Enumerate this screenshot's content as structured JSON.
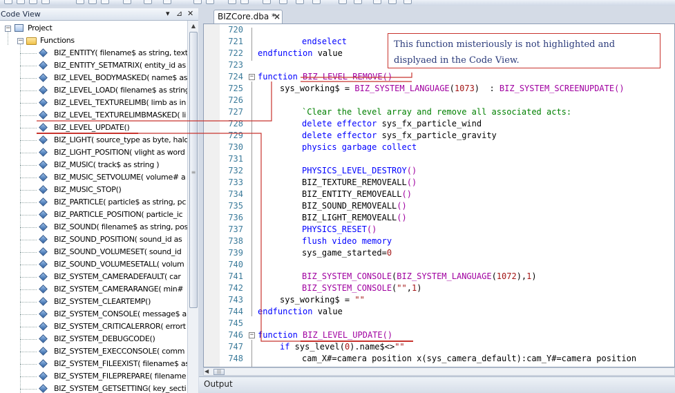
{
  "left_panel": {
    "title": "Code View",
    "pin_icon": "pin-icon",
    "close_icon": "close-icon",
    "tree": {
      "project": "Project",
      "functions_folder": "Functions",
      "items": [
        "BIZ_ENTITY( filename$ as string, text",
        "BIZ_ENTITY_SETMATRIX( entity_id as",
        "BIZ_LEVEL_BODYMASKED( name$ as",
        "BIZ_LEVEL_LOAD( filename$ as string",
        "BIZ_LEVEL_TEXTURELIMB( limb as in",
        "BIZ_LEVEL_TEXTURELIMBMASKED( li",
        "BIZ_LEVEL_UPDATE()",
        "BIZ_LIGHT( source_type as byte, halo",
        "BIZ_LIGHT_POSITION( vlight as word",
        "BIZ_MUSIC( track$ as string )",
        "BIZ_MUSIC_SETVOLUME( volume# a",
        "BIZ_MUSIC_STOP()",
        "BIZ_PARTICLE( particle$ as string, pc",
        "BIZ_PARTICLE_POSITION( particle_ic",
        "BIZ_SOUND( filename$ as string, pos",
        "BIZ_SOUND_POSITION( sound_id as",
        "BIZ_SOUND_VOLUMESET( sound_id",
        "BIZ_SOUND_VOLUMESETALL( volum",
        "BIZ_SYSTEM_CAMERADEFAULT( car",
        "BIZ_SYSTEM_CAMERARANGE( min#",
        "BIZ_SYSTEM_CLEARTEMP()",
        "BIZ_SYSTEM_CONSOLE( message$ a",
        "BIZ_SYSTEM_CRITICALERROR( errort",
        "BIZ_SYSTEM_DEBUGCODE()",
        "BIZ_SYSTEM_EXECCONSOLE( comm",
        "BIZ_SYSTEM_FILEEXIST( filename$ as",
        "BIZ_SYSTEM_FILEPREPARE( filename",
        "BIZ_SYSTEM_GETSETTING( key_secti"
      ]
    }
  },
  "editor": {
    "tab_label": "BIZCore.dba *",
    "tab_close": "×",
    "lines": [
      {
        "n": "720",
        "indent": 0,
        "tokens": []
      },
      {
        "n": "721",
        "indent": 2,
        "tokens": [
          {
            "t": "kw",
            "v": "endselect"
          }
        ]
      },
      {
        "n": "722",
        "indent": 0,
        "tokens": [
          {
            "t": "kw",
            "v": "endfunction"
          },
          {
            "t": "pl",
            "v": " value"
          }
        ]
      },
      {
        "n": "723",
        "indent": 0,
        "tokens": []
      },
      {
        "n": "724",
        "indent": 0,
        "tokens": [
          {
            "t": "kw",
            "v": "function"
          },
          {
            "t": "pl",
            "v": " "
          },
          {
            "t": "fnc",
            "v": "BIZ_LEVEL_REMOVE"
          },
          {
            "t": "fnc",
            "v": "()"
          }
        ]
      },
      {
        "n": "725",
        "indent": 1,
        "tokens": [
          {
            "t": "pl",
            "v": "sys_working$ = "
          },
          {
            "t": "fnc",
            "v": "BIZ_SYSTEM_LANGUAGE"
          },
          {
            "t": "pl",
            "v": "("
          },
          {
            "t": "st",
            "v": "1073"
          },
          {
            "t": "pl",
            "v": ")  : "
          },
          {
            "t": "fnc",
            "v": "BIZ_SYSTEM_SCREENUPDATE"
          },
          {
            "t": "fnc",
            "v": "()"
          }
        ]
      },
      {
        "n": "726",
        "indent": 0,
        "tokens": []
      },
      {
        "n": "727",
        "indent": 2,
        "tokens": [
          {
            "t": "cm",
            "v": "`Clear the level array and remove all associated acts:"
          }
        ]
      },
      {
        "n": "728",
        "indent": 2,
        "tokens": [
          {
            "t": "kw",
            "v": "delete effector"
          },
          {
            "t": "pl",
            "v": " sys_fx_particle_wind"
          }
        ]
      },
      {
        "n": "729",
        "indent": 2,
        "tokens": [
          {
            "t": "kw",
            "v": "delete effector"
          },
          {
            "t": "pl",
            "v": " sys_fx_particle_gravity"
          }
        ]
      },
      {
        "n": "730",
        "indent": 2,
        "tokens": [
          {
            "t": "kw",
            "v": "physics garbage collect"
          }
        ]
      },
      {
        "n": "731",
        "indent": 0,
        "tokens": []
      },
      {
        "n": "732",
        "indent": 2,
        "tokens": [
          {
            "t": "kw",
            "v": "PHYSICS_LEVEL_DESTROY"
          },
          {
            "t": "fnc",
            "v": "()"
          }
        ]
      },
      {
        "n": "733",
        "indent": 2,
        "tokens": [
          {
            "t": "pl",
            "v": "BIZ_TEXTURE_REMOVEALL"
          },
          {
            "t": "fnc",
            "v": "()"
          }
        ]
      },
      {
        "n": "734",
        "indent": 2,
        "tokens": [
          {
            "t": "pl",
            "v": "BIZ_ENTITY_REMOVEALL"
          },
          {
            "t": "fnc",
            "v": "()"
          }
        ]
      },
      {
        "n": "735",
        "indent": 2,
        "tokens": [
          {
            "t": "pl",
            "v": "BIZ_SOUND_REMOVEALL"
          },
          {
            "t": "fnc",
            "v": "()"
          }
        ]
      },
      {
        "n": "736",
        "indent": 2,
        "tokens": [
          {
            "t": "pl",
            "v": "BIZ_LIGHT_REMOVEALL"
          },
          {
            "t": "fnc",
            "v": "()"
          }
        ]
      },
      {
        "n": "737",
        "indent": 2,
        "tokens": [
          {
            "t": "kw",
            "v": "PHYSICS_RESET"
          },
          {
            "t": "fnc",
            "v": "()"
          }
        ]
      },
      {
        "n": "738",
        "indent": 2,
        "tokens": [
          {
            "t": "kw",
            "v": "flush video memory"
          }
        ]
      },
      {
        "n": "739",
        "indent": 2,
        "tokens": [
          {
            "t": "pl",
            "v": "sys_game_started="
          },
          {
            "t": "st",
            "v": "0"
          }
        ]
      },
      {
        "n": "740",
        "indent": 0,
        "tokens": []
      },
      {
        "n": "741",
        "indent": 2,
        "tokens": [
          {
            "t": "fnc",
            "v": "BIZ_SYSTEM_CONSOLE"
          },
          {
            "t": "pl",
            "v": "("
          },
          {
            "t": "fnc",
            "v": "BIZ_SYSTEM_LANGUAGE"
          },
          {
            "t": "pl",
            "v": "("
          },
          {
            "t": "st",
            "v": "1072"
          },
          {
            "t": "pl",
            "v": "),"
          },
          {
            "t": "st",
            "v": "1"
          },
          {
            "t": "pl",
            "v": ")"
          }
        ]
      },
      {
        "n": "742",
        "indent": 2,
        "tokens": [
          {
            "t": "fnc",
            "v": "BIZ_SYSTEM_CONSOLE"
          },
          {
            "t": "pl",
            "v": "("
          },
          {
            "t": "st",
            "v": "\"\""
          },
          {
            "t": "pl",
            "v": ","
          },
          {
            "t": "st",
            "v": "1"
          },
          {
            "t": "pl",
            "v": ")"
          }
        ]
      },
      {
        "n": "743",
        "indent": 1,
        "tokens": [
          {
            "t": "pl",
            "v": "sys_working$ = "
          },
          {
            "t": "st",
            "v": "\"\""
          }
        ]
      },
      {
        "n": "744",
        "indent": 0,
        "tokens": [
          {
            "t": "kw",
            "v": "endfunction"
          },
          {
            "t": "pl",
            "v": " value"
          }
        ]
      },
      {
        "n": "745",
        "indent": 0,
        "tokens": []
      },
      {
        "n": "746",
        "indent": 0,
        "tokens": [
          {
            "t": "kw",
            "v": "function"
          },
          {
            "t": "pl",
            "v": " "
          },
          {
            "t": "fnc",
            "v": "BIZ_LEVEL_UPDATE"
          },
          {
            "t": "fnc",
            "v": "()"
          }
        ]
      },
      {
        "n": "747",
        "indent": 1,
        "tokens": [
          {
            "t": "kw",
            "v": "if"
          },
          {
            "t": "pl",
            "v": " sys_level("
          },
          {
            "t": "st",
            "v": "0"
          },
          {
            "t": "pl",
            "v": ").name$<>"
          },
          {
            "t": "st",
            "v": "\"\""
          }
        ]
      },
      {
        "n": "748",
        "indent": 2,
        "tokens": [
          {
            "t": "pl",
            "v": "cam_X#=camera position x(sys_camera_default):cam_Y#=camera position"
          }
        ]
      }
    ]
  },
  "output": {
    "title": "Output"
  },
  "annotation": {
    "text": "This function misteriously is not highlighted and displyaed in the Code View.",
    "color": "#c8332d"
  },
  "colors": {
    "keyword": "#0000ff",
    "function": "#a000a0",
    "comment": "#008000",
    "string": "#a31515",
    "line_number": "#3a7a9a"
  }
}
